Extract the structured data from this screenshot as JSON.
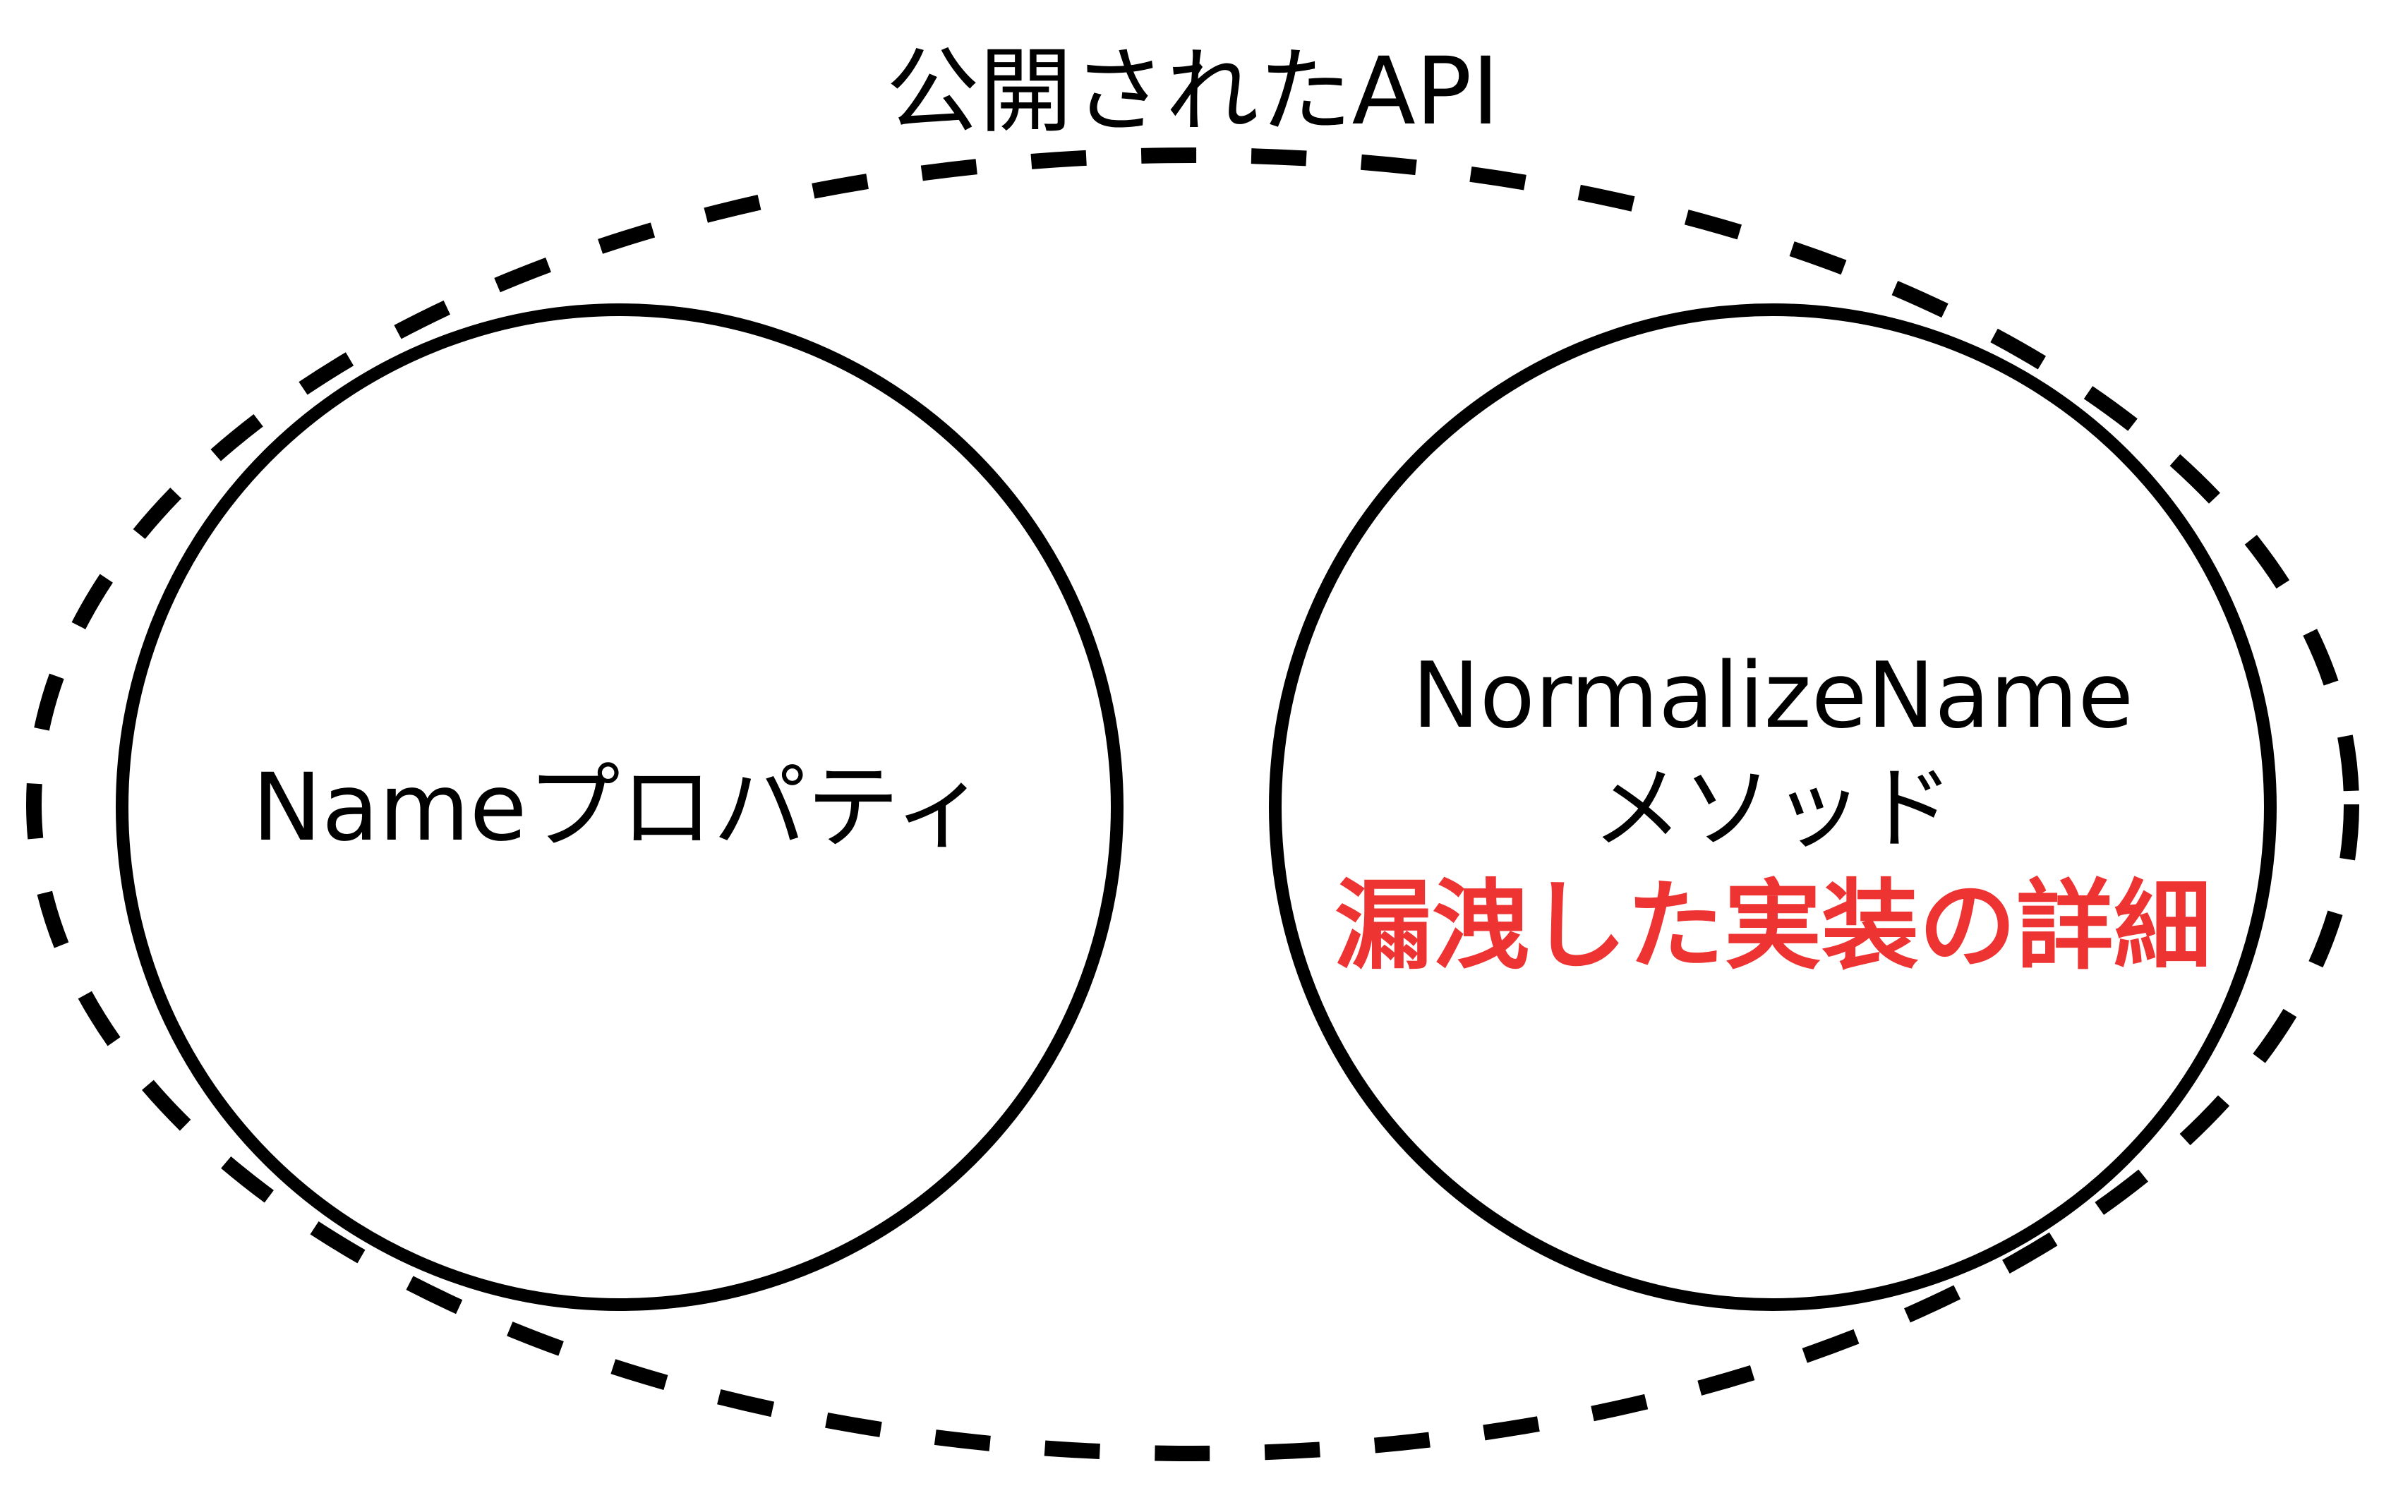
{
  "outer_group": {
    "title": "公開されたAPI"
  },
  "left_node": {
    "label": "Nameプロパティ"
  },
  "right_node": {
    "line1": "NormalizeName",
    "line2": "メソッド",
    "highlight": "漏洩した実装の詳細"
  },
  "colors": {
    "stroke": "#000000",
    "highlight": "#ee3333",
    "background": "#ffffff"
  }
}
